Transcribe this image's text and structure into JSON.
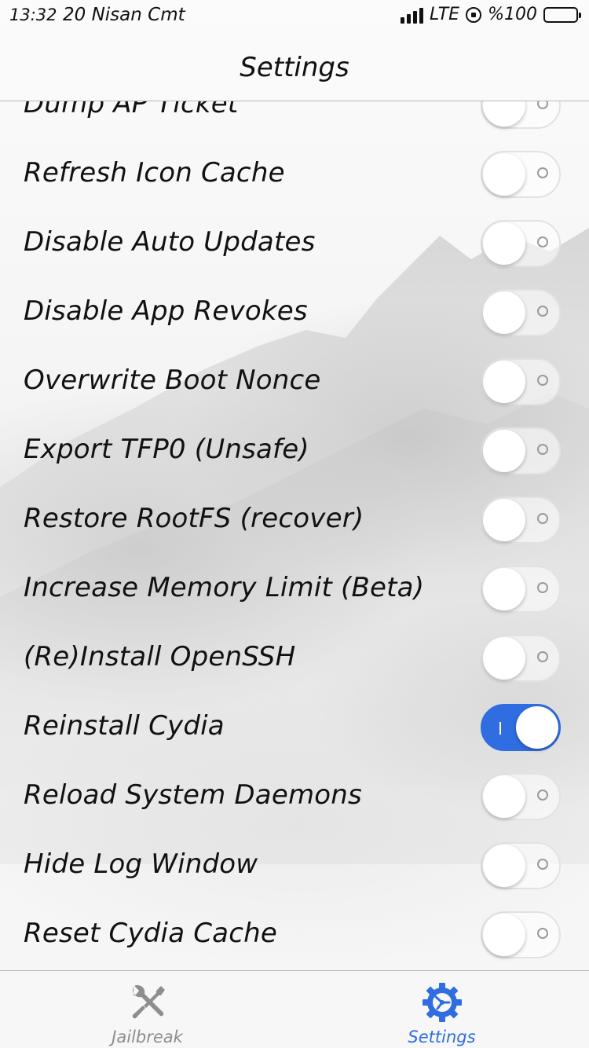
{
  "status_bar": {
    "time": "13:32",
    "date": "20 Nisan Cmt",
    "network": "LTE",
    "battery": "%100"
  },
  "nav": {
    "title": "Settings"
  },
  "settings": {
    "items": [
      {
        "label": "Dump AP Ticket",
        "on": false
      },
      {
        "label": "Refresh Icon Cache",
        "on": false
      },
      {
        "label": "Disable Auto Updates",
        "on": false
      },
      {
        "label": "Disable App Revokes",
        "on": false
      },
      {
        "label": "Overwrite Boot Nonce",
        "on": false
      },
      {
        "label": "Export TFP0 (Unsafe)",
        "on": false
      },
      {
        "label": "Restore RootFS (recover)",
        "on": false
      },
      {
        "label": "Increase Memory Limit (Beta)",
        "on": false
      },
      {
        "label": "(Re)Install OpenSSH",
        "on": false
      },
      {
        "label": "Reinstall Cydia",
        "on": true
      },
      {
        "label": "Reload System Daemons",
        "on": false
      },
      {
        "label": "Hide Log Window",
        "on": false
      },
      {
        "label": "Reset Cydia Cache",
        "on": false
      }
    ]
  },
  "tabs": [
    {
      "label": "Jailbreak",
      "icon": "tools-icon",
      "selected": false
    },
    {
      "label": "Settings",
      "icon": "gear-icon",
      "selected": true
    }
  ],
  "colors": {
    "accent": "#2f6de0",
    "inactive_tab": "#8e8e8e"
  }
}
